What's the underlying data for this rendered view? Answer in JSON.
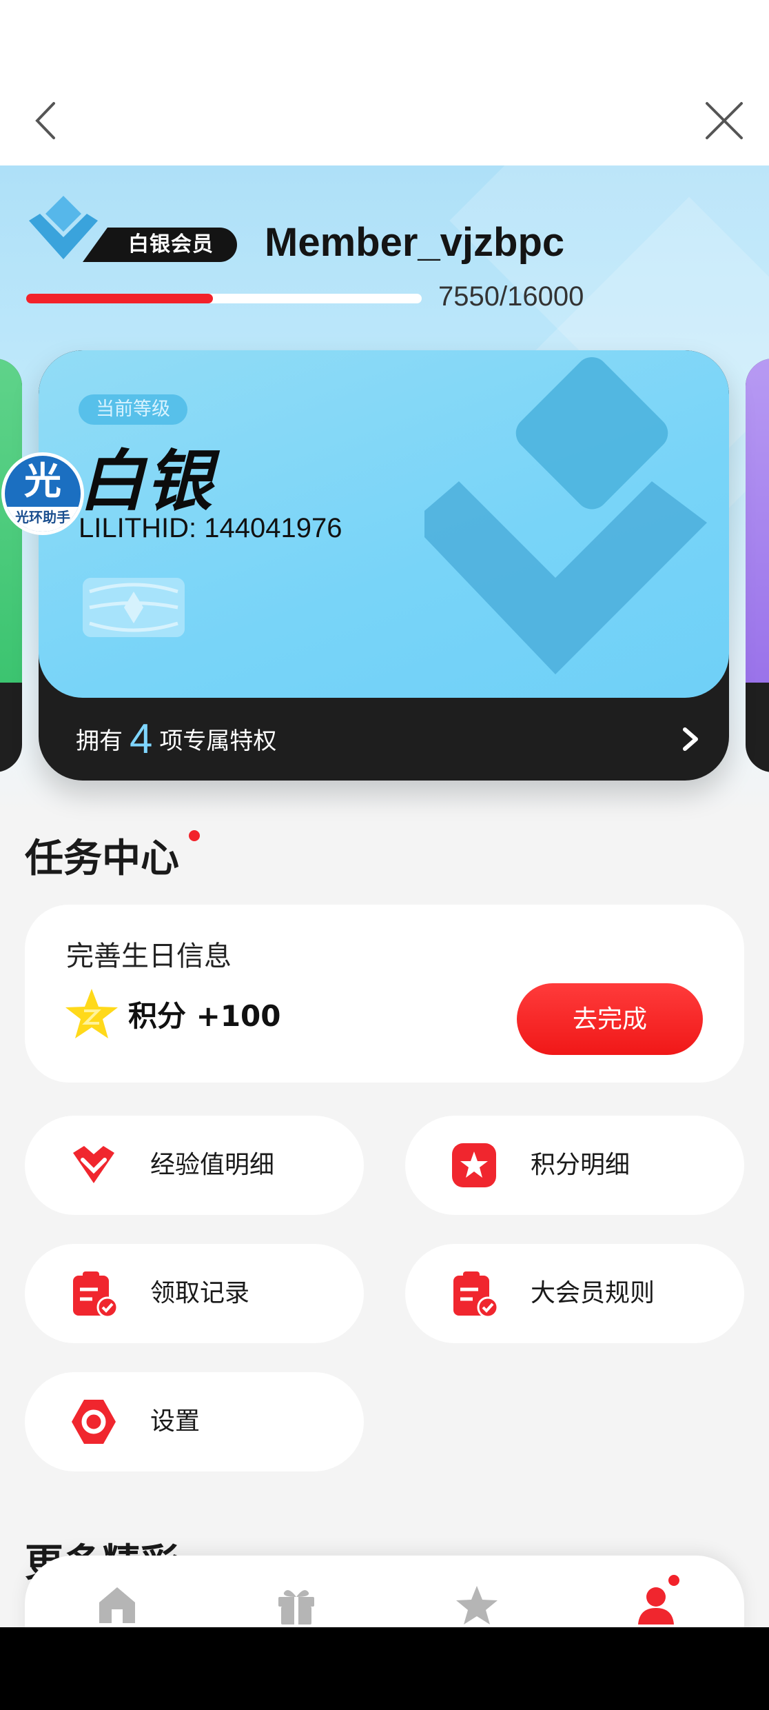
{
  "header": {
    "back_icon": "chevron-left-icon",
    "close_icon": "close-x-icon"
  },
  "member": {
    "tier_badge": "白银会员",
    "username": "Member_vjzbpc",
    "progress_text": "7550/16000",
    "progress_value": 0.4719,
    "accent_color": "#f2222a"
  },
  "card": {
    "level_chip": "当前等级",
    "level_name": "白银",
    "lilith_id": "LILITHID: 144041976",
    "perk_prefix": "拥有",
    "perk_count": "4",
    "perk_suffix": "项专属特权",
    "card_color": "#78d4f8"
  },
  "helper": {
    "line1": "光",
    "line2": "光环助手"
  },
  "task_center": {
    "title": "任务中心",
    "task": {
      "title": "完善生日信息",
      "reward": "积分 +100",
      "button": "去完成"
    }
  },
  "menu": [
    {
      "label": "经验值明细",
      "icon": "diamond-heart-icon"
    },
    {
      "label": "积分明细",
      "icon": "star-badge-icon"
    },
    {
      "label": "领取记录",
      "icon": "clipboard-check-icon"
    },
    {
      "label": "大会员规则",
      "icon": "clipboard-check-icon"
    },
    {
      "label": "设置",
      "icon": "settings-hexagon-icon"
    }
  ],
  "more_section": {
    "title": "更多精彩"
  },
  "bottom_nav": [
    {
      "name": "home",
      "icon": "home-icon"
    },
    {
      "name": "gifts",
      "icon": "gift-icon"
    },
    {
      "name": "points",
      "icon": "star-icon"
    },
    {
      "name": "profile",
      "icon": "user-icon",
      "active": true
    }
  ]
}
